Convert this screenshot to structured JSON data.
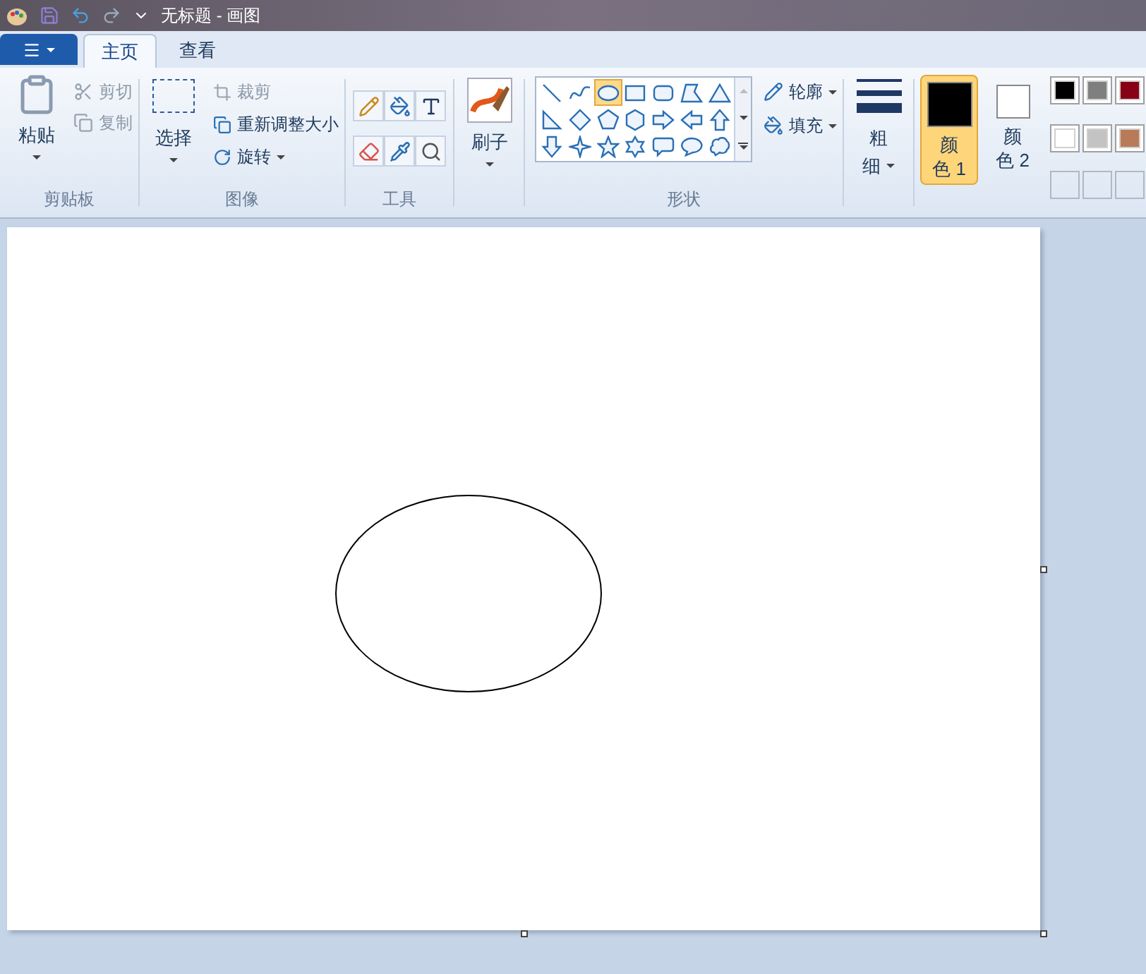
{
  "window": {
    "title": "无标题 - 画图"
  },
  "menu_button": {
    "kind": "app-menu"
  },
  "tabs": [
    {
      "label": "主页",
      "selected": true
    },
    {
      "label": "查看",
      "selected": false
    }
  ],
  "clipboard": {
    "label": "剪贴板",
    "paste": "粘贴",
    "items": [
      {
        "label": "剪切",
        "kind": "cut",
        "disabled": true
      },
      {
        "label": "复制",
        "kind": "copy",
        "disabled": true
      }
    ]
  },
  "image": {
    "label": "图像",
    "select": "选择",
    "items": [
      {
        "label": "裁剪",
        "kind": "crop",
        "disabled": true,
        "dropdown": false
      },
      {
        "label": "重新调整大小",
        "kind": "resize",
        "disabled": false,
        "dropdown": false
      },
      {
        "label": "旋转",
        "kind": "rotate",
        "disabled": false,
        "dropdown": true
      }
    ]
  },
  "tools": {
    "label": "工具",
    "items": [
      {
        "kind": "pencil",
        "selected": false
      },
      {
        "kind": "fill",
        "selected": false
      },
      {
        "kind": "text",
        "selected": false
      },
      {
        "kind": "eraser",
        "selected": false
      },
      {
        "kind": "picker",
        "selected": false
      },
      {
        "kind": "magnifier",
        "selected": false
      }
    ]
  },
  "brush": {
    "label": "刷子"
  },
  "shapes": {
    "label": "形状",
    "items": [
      {
        "kind": "line",
        "selected": false
      },
      {
        "kind": "curve",
        "selected": false
      },
      {
        "kind": "oval",
        "selected": true
      },
      {
        "kind": "rectangle",
        "selected": false
      },
      {
        "kind": "rounded-rectangle",
        "selected": false
      },
      {
        "kind": "polygon",
        "selected": false
      },
      {
        "kind": "triangle",
        "selected": false
      },
      {
        "kind": "right-triangle",
        "selected": false
      },
      {
        "kind": "diamond",
        "selected": false
      },
      {
        "kind": "pentagon",
        "selected": false
      },
      {
        "kind": "hexagon",
        "selected": false
      },
      {
        "kind": "right-arrow",
        "selected": false
      },
      {
        "kind": "left-arrow",
        "selected": false
      },
      {
        "kind": "up-arrow",
        "selected": false
      },
      {
        "kind": "down-arrow",
        "selected": false
      },
      {
        "kind": "four-point-star",
        "selected": false
      },
      {
        "kind": "five-point-star",
        "selected": false
      },
      {
        "kind": "six-point-star",
        "selected": false
      },
      {
        "kind": "rounded-callout",
        "selected": false
      },
      {
        "kind": "oval-callout",
        "selected": false
      },
      {
        "kind": "cloud-callout",
        "selected": false
      }
    ],
    "outline": "轮廓",
    "fill": "填充"
  },
  "size": {
    "label_top": "粗",
    "label_bottom": "细"
  },
  "color_wells": [
    {
      "label_top": "颜",
      "label_bottom": "色 1",
      "color": "#000000",
      "selected": true
    },
    {
      "label_top": "颜",
      "label_bottom": "色 2",
      "color": "#ffffff",
      "selected": false
    }
  ],
  "palette": [
    {
      "color": "#000000"
    },
    {
      "color": "#7f7f7f"
    },
    {
      "color": "#880015"
    },
    {
      "color": "#ffffff"
    },
    {
      "color": "#c3c3c3"
    },
    {
      "color": "#b97a57"
    }
  ],
  "canvas": {
    "shape": {
      "kind": "ellipse"
    }
  }
}
